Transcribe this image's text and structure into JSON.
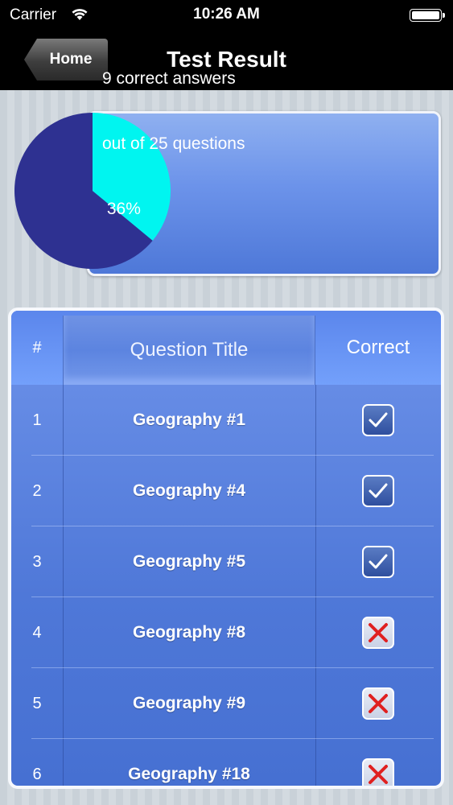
{
  "status_bar": {
    "carrier": "Carrier",
    "time": "10:26 AM"
  },
  "nav": {
    "back_label": "Home",
    "title": "Test Result"
  },
  "summary": {
    "line1": "9 correct answers",
    "line2": "out of 25 questions",
    "line3": " 36%",
    "correct_fraction": 0.36,
    "colors": {
      "correct": "#00f5f0",
      "incorrect": "#2e3191"
    }
  },
  "table": {
    "headers": {
      "number": "#",
      "title": "Question Title",
      "correct": "Correct"
    },
    "rows": [
      {
        "num": "1",
        "title": "Geography #1",
        "correct": true
      },
      {
        "num": "2",
        "title": "Geography #4",
        "correct": true
      },
      {
        "num": "3",
        "title": "Geography #5",
        "correct": true
      },
      {
        "num": "4",
        "title": "Geography #8",
        "correct": false
      },
      {
        "num": "5",
        "title": "Geography #9",
        "correct": false
      },
      {
        "num": "6",
        "title": "Geography #18",
        "correct": false
      }
    ]
  }
}
